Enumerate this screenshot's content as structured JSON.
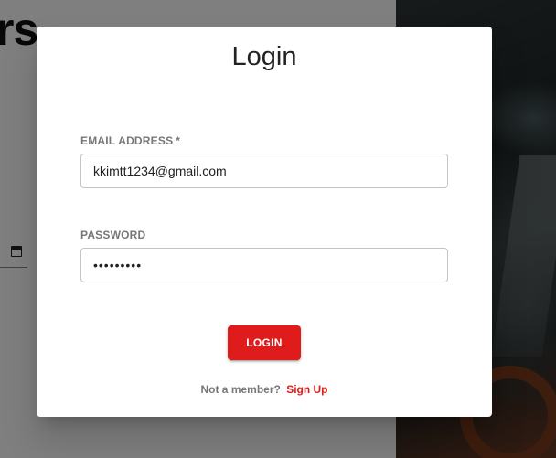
{
  "background": {
    "heading_fragment": "rs",
    "calendar_icon": "calendar-icon"
  },
  "login_dialog": {
    "title": "Login",
    "email": {
      "label": "EMAIL ADDRESS",
      "required_marker": "*",
      "value": "kkimtt1234@gmail.com"
    },
    "password": {
      "label": "PASSWORD",
      "value": "passwords"
    },
    "submit_label": "LOGIN",
    "signup_prompt": "Not a member?",
    "signup_link": "Sign Up"
  },
  "colors": {
    "accent": "#e01b1b",
    "label_gray": "#777777",
    "overlay": "rgba(0,0,0,0.5)"
  }
}
